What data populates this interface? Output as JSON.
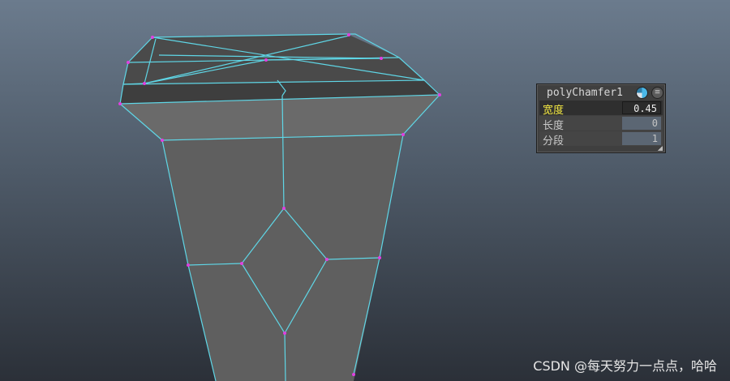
{
  "chamfer_panel": {
    "title": "polyChamfer1",
    "menu_glyph": "≡",
    "attributes": [
      {
        "label": "宽度",
        "value": "0.45"
      },
      {
        "label": "长度",
        "value": "0"
      },
      {
        "label": "分段",
        "value": "1"
      }
    ]
  },
  "watermark": "CSDN @每天努力一点点，哈哈",
  "colors": {
    "wireframe_edge": "#5fd6e6",
    "vertex": "#e040e0",
    "active_label": "#f4e842",
    "face_front": "#5f5f5f",
    "face_top": "#4a4a4a"
  },
  "icons": [
    "attribute-editor-icon",
    "menu-icon",
    "resize-grip-icon"
  ]
}
